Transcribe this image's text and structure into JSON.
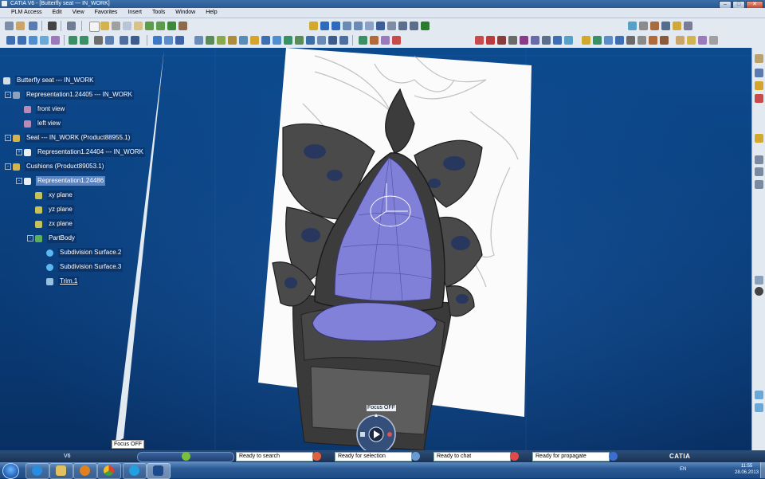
{
  "window": {
    "title": "CATIA V6 - [Butterfly seat --- IN_WORK]",
    "buttons": [
      "–",
      "□",
      "✕"
    ]
  },
  "menu": [
    "PLM Access",
    "Edit",
    "View",
    "Favorites",
    "Insert",
    "Tools",
    "Window",
    "Help"
  ],
  "tree": {
    "root": "Butterfly seat --- IN_WORK",
    "rep1": "Representation1.24405 --- IN_WORK",
    "front_view": "front view",
    "left_view": "left view",
    "seat": "Seat --- IN_WORK (Product88955.1)",
    "rep2": "Representation1.24404 --- IN_WORK",
    "cushions": "Cushions (Product89053.1)",
    "rep3": "Representation1.24486",
    "xy": "xy plane",
    "yz": "yz plane",
    "zx": "zx plane",
    "partbody": "PartBody",
    "subd2": "Subdivision Surface.2",
    "subd3": "Subdivision Surface.3",
    "trim": "Trim.1"
  },
  "viewport": {
    "focus_label": "Focus OFF",
    "robot_label": "Focus OFF"
  },
  "statusbar": {
    "app_short": "V6",
    "fields": [
      "Ready to search",
      "Ready for selection",
      "Ready to chat",
      "Ready for propagate"
    ],
    "brand": "CATIA"
  },
  "taskbar": {
    "language": "EN",
    "time": "11:55",
    "date": "28.06.2013"
  },
  "colors": {
    "viewport_bg": "#0a3c7a",
    "surface_purple": "#7f7fd6",
    "mesh_dark": "#4a4a4a",
    "selection": "#5a83c2"
  }
}
